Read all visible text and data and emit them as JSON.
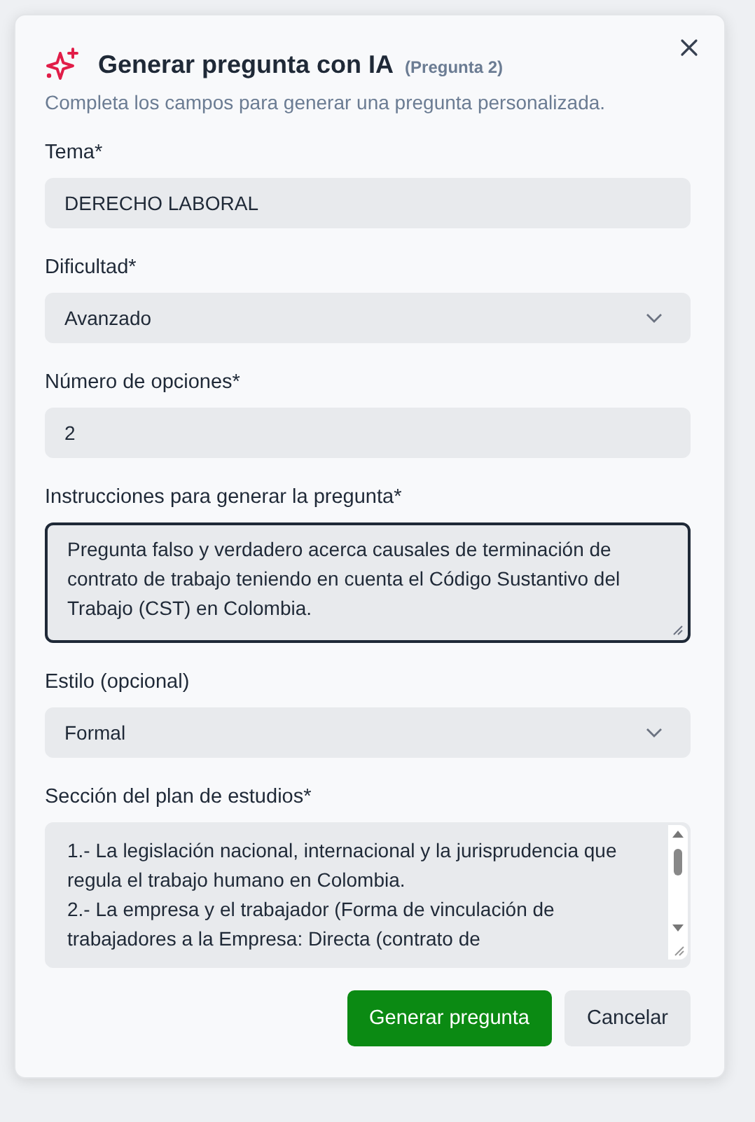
{
  "dialog": {
    "title": "Generar pregunta con IA",
    "tag": "(Pregunta 2)",
    "subtitle": "Completa los campos para generar una pregunta personalizada."
  },
  "fields": [
    {
      "kind": "text",
      "label": "Tema*",
      "value": "DERECHO LABORAL",
      "focused": false
    },
    {
      "kind": "select",
      "label": "Dificultad*",
      "value": "Avanzado",
      "focused": false
    },
    {
      "kind": "text",
      "label": "Número de opciones*",
      "value": "2",
      "focused": false
    },
    {
      "kind": "textarea",
      "label": "Instrucciones para generar la pregunta*",
      "value": "Pregunta falso y verdadero acerca causales de terminación de contrato de trabajo teniendo en cuenta el Código Sustantivo del Trabajo (CST) en Colombia.",
      "focused": true
    },
    {
      "kind": "select",
      "label": "Estilo (opcional)",
      "value": "Formal",
      "focused": false
    },
    {
      "kind": "scrolltext",
      "label": "Sección del plan de estudios*",
      "value": "1.- La legislación nacional, internacional y la jurisprudencia que regula el trabajo humano en Colombia.\n2.- La empresa y el trabajador (Forma de vinculación de trabajadores a la Empresa: Directa (contrato de",
      "focused": false
    }
  ],
  "buttons": [
    {
      "label": "Generar pregunta",
      "kind": "primary"
    },
    {
      "label": "Cancelar",
      "kind": "secondary"
    }
  ]
}
